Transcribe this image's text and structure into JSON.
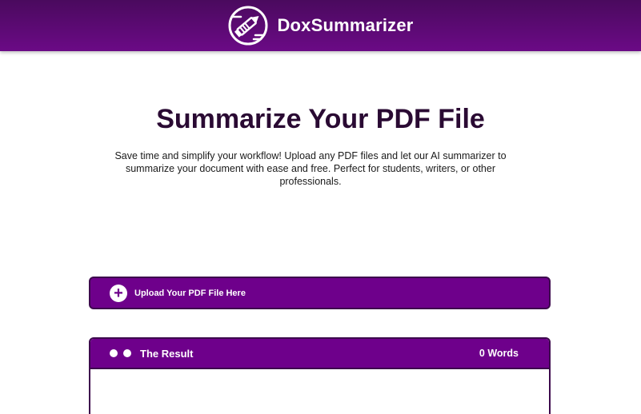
{
  "header": {
    "brand_name": "DoxSummarizer",
    "logo_icon": "pencil-in-circle-icon",
    "background_color": "#6b0a86"
  },
  "hero": {
    "title": "Summarize Your PDF File",
    "description": "Save time and simplify your workflow! Upload any PDF files and let our AI summarizer to summarize your document with ease and free. Perfect for students, writers, or other professionals."
  },
  "upload": {
    "icon": "plus-circle-icon",
    "label": "Upload Your PDF File Here",
    "color": "#6e008b"
  },
  "result": {
    "title": "The Result",
    "word_count": "0 Words",
    "window_dots": [
      "dot",
      "dot"
    ],
    "border_color": "#3d0a4d"
  }
}
